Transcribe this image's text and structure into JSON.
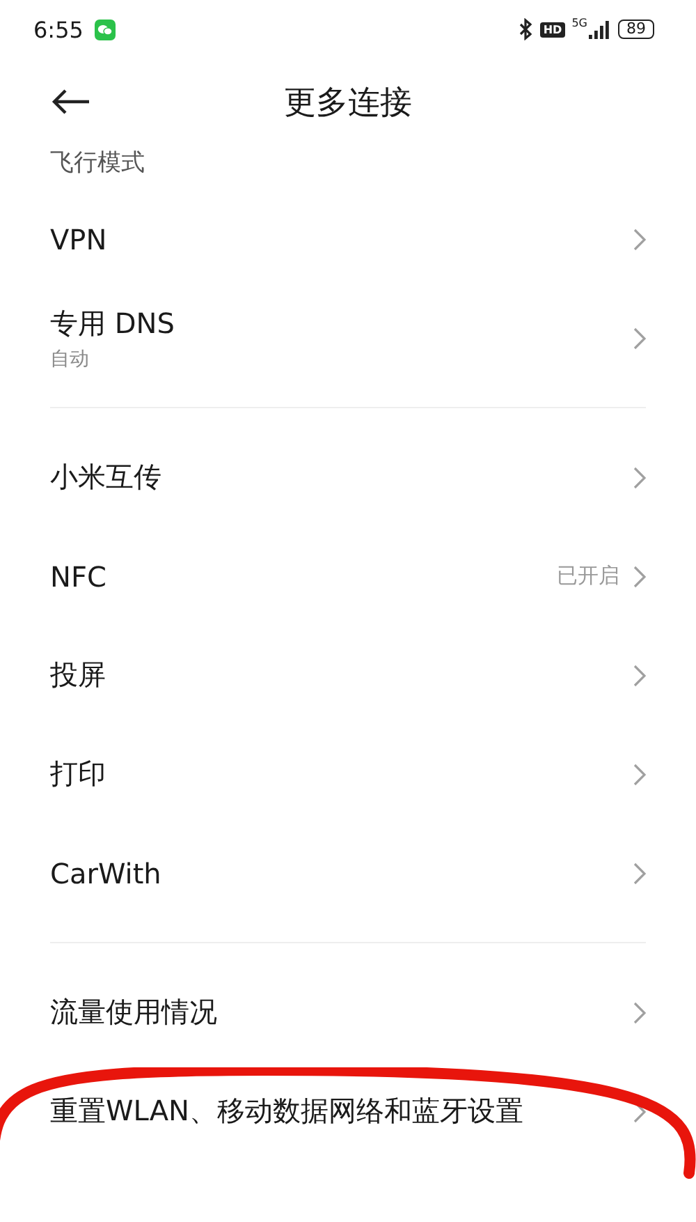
{
  "status_bar": {
    "time": "6:55",
    "network_badge": "HD",
    "network_type": "5G",
    "battery": "89"
  },
  "header": {
    "title": "更多连接"
  },
  "sections": [
    {
      "items": [
        {
          "label": "飞行模式",
          "compact": true
        },
        {
          "label": "VPN"
        },
        {
          "label": "专用 DNS",
          "subtitle": "自动"
        }
      ]
    },
    {
      "items": [
        {
          "label": "小米互传"
        },
        {
          "label": "NFC",
          "value": "已开启"
        },
        {
          "label": "投屏"
        },
        {
          "label": "打印"
        },
        {
          "label": "CarWith"
        }
      ]
    },
    {
      "items": [
        {
          "label": "流量使用情况"
        },
        {
          "label": "重置WLAN、移动数据网络和蓝牙设置",
          "circled": true
        }
      ]
    }
  ]
}
